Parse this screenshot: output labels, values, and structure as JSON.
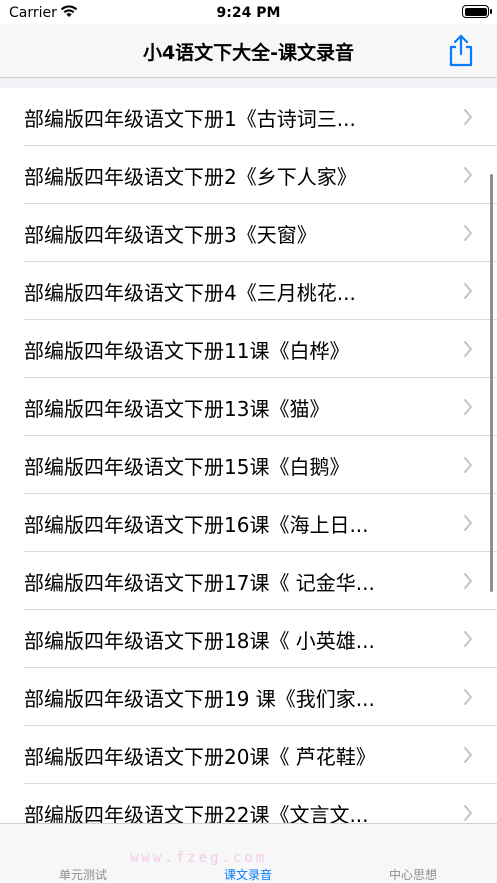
{
  "status_bar": {
    "carrier": "Carrier",
    "time": "9:24 PM"
  },
  "nav": {
    "title": "小4语文下大全-课文录音",
    "share_icon": "share-icon"
  },
  "colors": {
    "accent": "#0a7aff",
    "inactive_tab": "#8e8e93",
    "separator": "#dcdcdf"
  },
  "list": {
    "items": [
      {
        "label": "部编版四年级语文下册1《古诗词三..."
      },
      {
        "label": "部编版四年级语文下册2《乡下人家》"
      },
      {
        "label": "部编版四年级语文下册3《天窗》"
      },
      {
        "label": "部编版四年级语文下册4《三月桃花..."
      },
      {
        "label": "部编版四年级语文下册11课《白桦》"
      },
      {
        "label": "部编版四年级语文下册13课《猫》"
      },
      {
        "label": "部编版四年级语文下册15课《白鹅》"
      },
      {
        "label": "部编版四年级语文下册16课《海上日..."
      },
      {
        "label": "部编版四年级语文下册17课《 记金华..."
      },
      {
        "label": "部编版四年级语文下册18课《 小英雄..."
      },
      {
        "label": "部编版四年级语文下册19 课《我们家..."
      },
      {
        "label": "部编版四年级语文下册20课《 芦花鞋》"
      },
      {
        "label": "部编版四年级语文下册22课《文言文..."
      }
    ]
  },
  "tabs": [
    {
      "label": "单元测试"
    },
    {
      "label": "课文录音"
    },
    {
      "label": "中心思想"
    }
  ],
  "watermark": "www.fzeg.com"
}
